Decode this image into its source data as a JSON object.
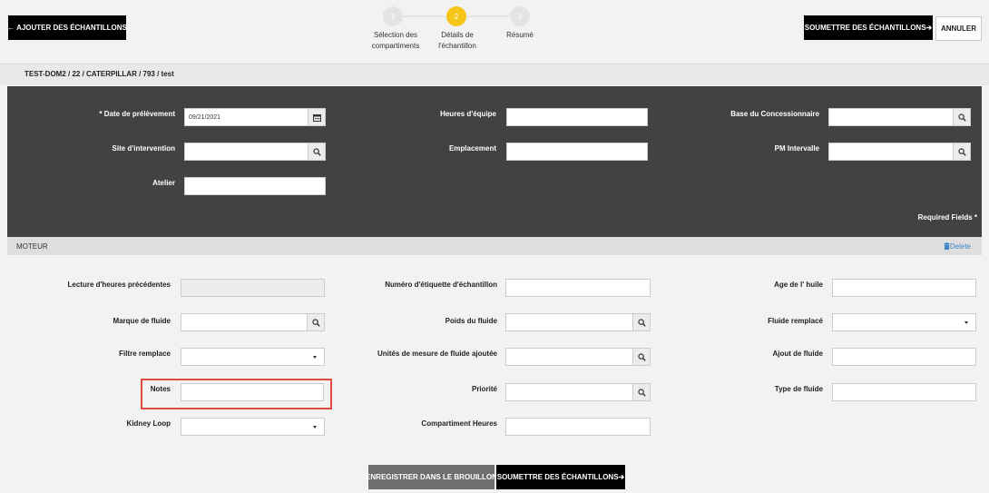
{
  "header": {
    "add_samples": "← AJOUTER DES ÉCHANTILLONS",
    "submit_samples": "SOUMETTRE DES ÉCHANTILLONS➔",
    "cancel": "ANNULER"
  },
  "stepper": {
    "steps": [
      {
        "number": "1",
        "label_line1": "Sélection des",
        "label_line2": "compartiments"
      },
      {
        "number": "2",
        "label_line1": "Détails de",
        "label_line2": "l'échantillon"
      },
      {
        "number": "3",
        "label_line1": "Résumé",
        "label_line2": ""
      }
    ],
    "active": 2
  },
  "breadcrumb": "TEST-DOM2 / 22 / CATERPILLAR / 793 / test",
  "general": {
    "date_label": "* Date de prélèvement",
    "date_value": "09/21/2021",
    "hours_label": "Heures d'équipe",
    "dealer_base_label": "Base du Concessionnaire",
    "site_label": "Site d'intervention",
    "location_label": "Emplacement",
    "pm_label": "PM Intervalle",
    "workshop_label": "Atelier",
    "required": "Required Fields *"
  },
  "section": {
    "title": "MOTEUR",
    "delete": "Delete"
  },
  "compartment": {
    "prev_hours_label": "Lecture d'heures précédentes",
    "sample_tag_label": "Numéro d'étiquette d'échantillon",
    "oil_age_label": "Age de l' huile",
    "fluid_brand_label": "Marque de fluide",
    "fluid_weight_label": "Poids du fluide",
    "fluid_replaced_label": "Fluide remplacé",
    "filter_replaced_label": "Filtre remplace",
    "fluid_units_label": "Unités de mesure de fluide ajoutée",
    "fluid_added_label": "Ajout de fluide",
    "notes_label": "Notes",
    "priority_label": "Priorité",
    "fluid_type_label": "Type de fluide",
    "kidney_loop_label": "Kidney Loop",
    "compartment_hours_label": "Compartiment Heures"
  },
  "footer": {
    "save_draft": "ENREGISTRER DANS LE BROUILLON",
    "submit_samples": "SOUMETTRE DES ÉCHANTILLONS➔"
  },
  "colors": {
    "accent": "#f5c518",
    "dark_panel": "#424242",
    "highlight": "#e04a40",
    "link": "#3a86c8"
  }
}
